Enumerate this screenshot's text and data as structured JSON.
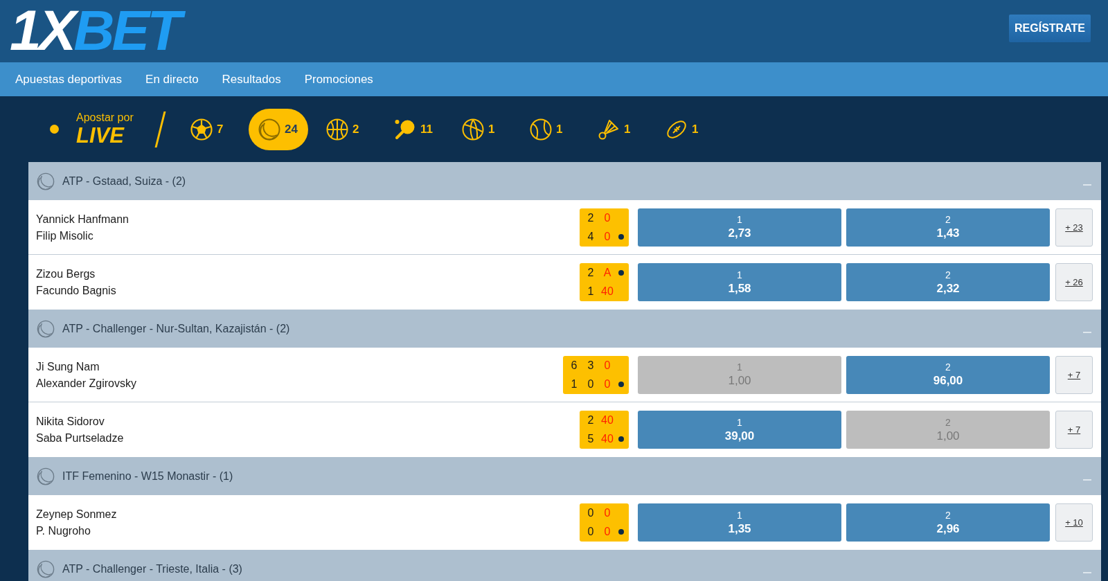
{
  "header": {
    "logo": {
      "text": "1X",
      "accent": "BET"
    },
    "register_button": "REGÍSTRATE"
  },
  "nav": [
    "Apuestas deportivas",
    "En directo",
    "Resultados",
    "Promociones"
  ],
  "live_bar": {
    "title": "Apostar por",
    "live": "LIVE",
    "sports": [
      {
        "kind": "soccer",
        "count": "7",
        "selected": false
      },
      {
        "kind": "tennis",
        "count": "24",
        "selected": true
      },
      {
        "kind": "basketball",
        "count": "2",
        "selected": false
      },
      {
        "kind": "table_tennis",
        "count": "11",
        "selected": false
      },
      {
        "kind": "volleyball",
        "count": "1",
        "selected": false
      },
      {
        "kind": "tennis_ball",
        "count": "1",
        "selected": false
      },
      {
        "kind": "badminton",
        "count": "1",
        "selected": false
      },
      {
        "kind": "rugby",
        "count": "1",
        "selected": false
      }
    ]
  },
  "groups": [
    {
      "title": "ATP - Gstaad, Suiza - (2)",
      "expanded": true,
      "matches": [
        {
          "players": [
            "Yannick Hanfmann",
            "Filip Misolic"
          ],
          "score": [
            {
              "cells": [
                "2",
                "0"
              ],
              "serving": false
            },
            {
              "cells": [
                "4",
                "0"
              ],
              "serving": true
            }
          ],
          "odds": [
            {
              "label": "1",
              "value": "2,73",
              "disabled": false
            },
            {
              "label": "2",
              "value": "1,43",
              "disabled": false
            }
          ],
          "more": "+ 23"
        },
        {
          "players": [
            "Zizou Bergs",
            "Facundo Bagnis"
          ],
          "score": [
            {
              "cells": [
                "2",
                "A"
              ],
              "serving": true
            },
            {
              "cells": [
                "1",
                "40"
              ],
              "serving": false
            }
          ],
          "odds": [
            {
              "label": "1",
              "value": "1,58",
              "disabled": false
            },
            {
              "label": "2",
              "value": "2,32",
              "disabled": false
            }
          ],
          "more": "+ 26"
        }
      ]
    },
    {
      "title": "ATP - Challenger - Nur-Sultan, Kazajistán - (2)",
      "expanded": true,
      "matches": [
        {
          "players": [
            "Ji Sung Nam",
            "Alexander Zgirovsky"
          ],
          "score": [
            {
              "cells": [
                "6",
                "3",
                "0"
              ],
              "serving": false
            },
            {
              "cells": [
                "1",
                "0",
                "0"
              ],
              "serving": true
            }
          ],
          "odds": [
            {
              "label": "1",
              "value": "1,00",
              "disabled": true
            },
            {
              "label": "2",
              "value": "96,00",
              "disabled": false
            }
          ],
          "more": "+ 7"
        },
        {
          "players": [
            "Nikita Sidorov",
            "Saba Purtseladze"
          ],
          "score": [
            {
              "cells": [
                "2",
                "40"
              ],
              "serving": false
            },
            {
              "cells": [
                "5",
                "40"
              ],
              "serving": true
            }
          ],
          "odds": [
            {
              "label": "1",
              "value": "39,00",
              "disabled": false
            },
            {
              "label": "2",
              "value": "1,00",
              "disabled": true
            }
          ],
          "more": "+ 7"
        }
      ]
    },
    {
      "title": "ITF Femenino - W15 Monastir - (1)",
      "expanded": true,
      "matches": [
        {
          "players": [
            "Zeynep Sonmez",
            "P. Nugroho"
          ],
          "score": [
            {
              "cells": [
                "0",
                "0"
              ],
              "serving": false
            },
            {
              "cells": [
                "0",
                "0"
              ],
              "serving": true
            }
          ],
          "odds": [
            {
              "label": "1",
              "value": "1,35",
              "disabled": false
            },
            {
              "label": "2",
              "value": "2,96",
              "disabled": false
            }
          ],
          "more": "+ 10"
        }
      ]
    },
    {
      "title": "ATP - Challenger - Trieste, Italia - (3)",
      "expanded": true
    }
  ]
}
